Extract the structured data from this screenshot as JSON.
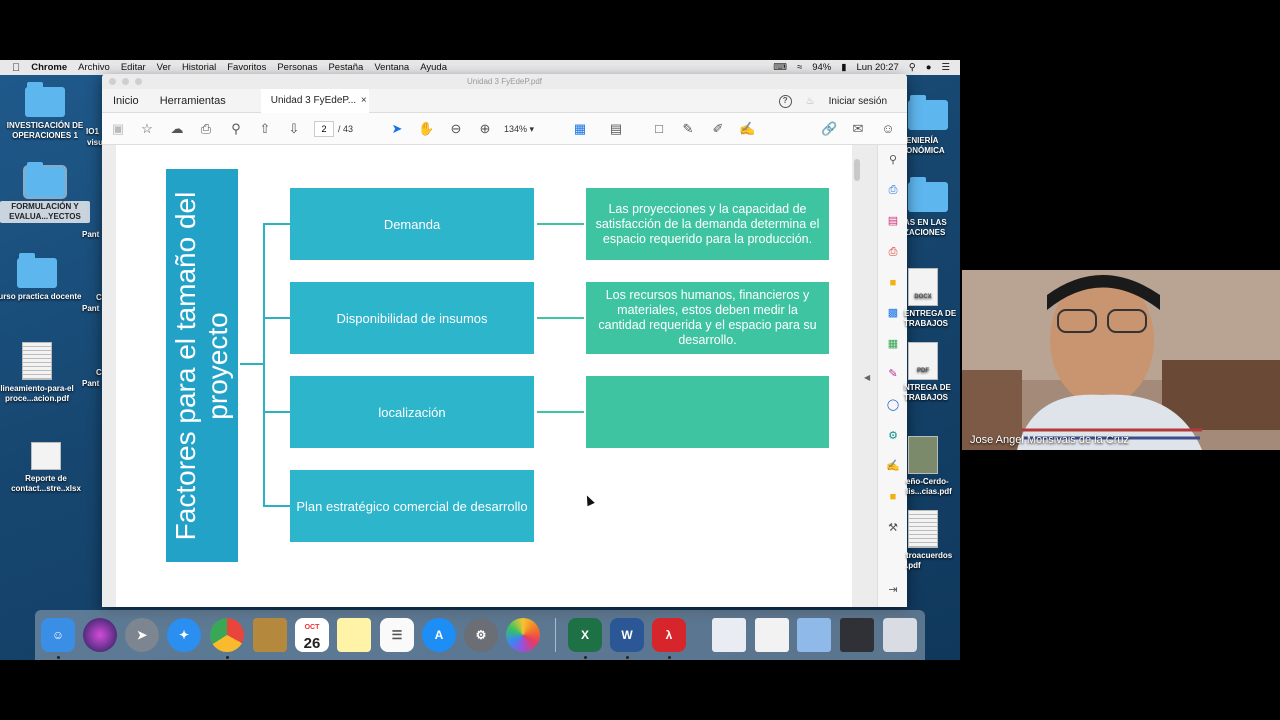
{
  "menubar": {
    "apple": "",
    "app": "Chrome",
    "items": [
      "Archivo",
      "Editar",
      "Ver",
      "Historial",
      "Favoritos",
      "Personas",
      "Pestaña",
      "Ventana",
      "Ayuda"
    ],
    "battery": "94%",
    "clock": "Lun 20:27"
  },
  "desktop_left": [
    {
      "label": "INVESTIGACIÓN DE OPERACIONES 1",
      "kind": "folder"
    },
    {
      "label": "FORMULACIÓN Y EVALUA...YECTOS",
      "kind": "folder"
    },
    {
      "label": "Curso practica docente",
      "kind": "folder"
    },
    {
      "label": "lineamiento-para-el proce...acion.pdf",
      "kind": "doc"
    },
    {
      "label": "Reporte de contact...stre..xlsx",
      "kind": "doc"
    }
  ],
  "desktop_frag": [
    "IO1",
    "visu",
    "Pant",
    "C",
    "Pant",
    "C",
    "Pant",
    "C",
    "Pant"
  ],
  "desktop_right": [
    {
      "label": "ENIERÍA ONÓMICA",
      "kind": "folder"
    },
    {
      "label": "AS EN LAS ZACIONES",
      "kind": "folder"
    },
    {
      "label": "ENTREGA DE TRABAJOS",
      "kind": "doc",
      "badge": "DOCX"
    },
    {
      "label": "NTREGA DE TRABAJOS",
      "kind": "doc",
      "badge": "PDF"
    },
    {
      "label": "eño-Cerdo- lis...cias.pdf",
      "kind": "doc"
    },
    {
      "label": "troacuerdos .pdf",
      "kind": "doc"
    }
  ],
  "acrobat": {
    "window_title": "Unidad 3 FyEdeP.pdf",
    "tab_home": "Inicio",
    "tab_tools": "Herramientas",
    "doc_tab": "Unidad 3 FyEdeP...",
    "close": "×",
    "help": "?",
    "sign_in": "Iniciar sesión",
    "page_current": "2",
    "page_total": "/ 43",
    "zoom": "134%"
  },
  "slide": {
    "title": "Factores para el tamaño del proyecto",
    "factors": [
      "Demanda",
      "Disponibilidad de insumos",
      "localización",
      "Plan estratégico comercial de desarrollo"
    ],
    "descriptions": [
      "Las proyecciones y la capacidad de satisfacción de la demanda determina el espacio requerido para la producción.",
      "Los recursos humanos, financieros y materiales, estos deben medir la cantidad requerida y el espacio para su desarrollo.",
      ""
    ],
    "colors": {
      "title_bar": "#21a2c6",
      "factor_box": "#2db5cc",
      "desc_box": "#3fc4a2"
    }
  },
  "webcam": {
    "name": "Jose Angel Monsivais de la Cruz"
  },
  "dock": {
    "calendar_month": "OCT",
    "calendar_day": "26"
  }
}
